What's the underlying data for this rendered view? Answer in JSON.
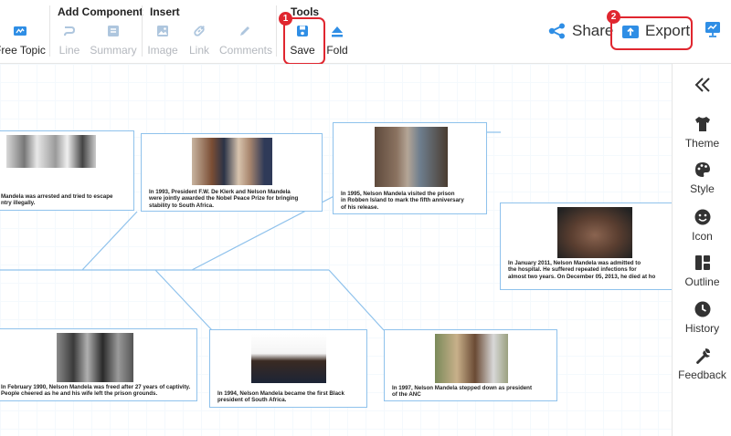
{
  "toolbar": {
    "free_topic_label": "Free Topic",
    "groups": {
      "add_component": "Add Component",
      "insert": "Insert",
      "tools": "Tools"
    },
    "line_label": "Line",
    "summary_label": "Summary",
    "image_label": "Image",
    "link_label": "Link",
    "comments_label": "Comments",
    "save_label": "Save",
    "fold_label": "Fold",
    "share_label": "Share",
    "export_label": "Export"
  },
  "annotations": {
    "badge_1": "1",
    "badge_2": "2",
    "highlight_color": "#e0262f"
  },
  "side_panel": {
    "items": [
      {
        "label": "Theme",
        "icon": "shirt-icon"
      },
      {
        "label": "Style",
        "icon": "palette-icon"
      },
      {
        "label": "Icon",
        "icon": "smiley-icon"
      },
      {
        "label": "Outline",
        "icon": "outline-icon"
      },
      {
        "label": "History",
        "icon": "clock-icon"
      },
      {
        "label": "Feedback",
        "icon": "wrench-icon"
      }
    ]
  },
  "mindmap": {
    "line_color": "#8fc2ec",
    "topics": [
      {
        "text": "Mandela was arrested and tried to escape\nntry illegally."
      },
      {
        "text": "In 1993, President F.W. De Klerk and Nelson Mandela\nwere jointly awarded the Nobel Peace Prize for bringing\nstability to South Africa."
      },
      {
        "text": "In 1995, Nelson Mandela visited the prison\nin Robben Island to mark the fifth anniversary\nof his release."
      },
      {
        "text": "In January 2011, Nelson Mandela was admitted to\nthe hospital. He suffered repeated infections for\nalmost two years. On December 05, 2013, he died at ho"
      },
      {
        "text": "In February 1990, Nelson Mandela was freed after 27 years of captivity.\nPeople cheered as he and his wife left the prison grounds."
      },
      {
        "text": "In 1994, Nelson Mandela became the first Black\npresident of South Africa."
      },
      {
        "text": "In 1997, Nelson Mandela stepped down as president\nof the ANC"
      }
    ]
  }
}
